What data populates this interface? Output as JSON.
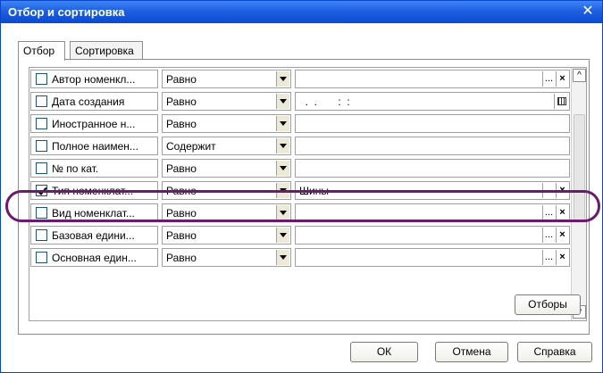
{
  "window": {
    "title": "Отбор и сортировка",
    "close_glyph": "✕"
  },
  "tabs": [
    {
      "label": "Отбор",
      "active": true
    },
    {
      "label": "Сортировка",
      "active": false
    }
  ],
  "rows": [
    {
      "checked": false,
      "name": "Автор номенкл...",
      "operator": "Равно",
      "value": "",
      "value_buttons": [
        "...",
        "×"
      ]
    },
    {
      "checked": false,
      "name": "Дата создания",
      "operator": "Равно",
      "value": "  .  .       :  :",
      "value_buttons": [
        "calendar"
      ]
    },
    {
      "checked": false,
      "name": "Иностранное н...",
      "operator": "Равно",
      "value": "",
      "value_buttons": []
    },
    {
      "checked": false,
      "name": "Полное наимен...",
      "operator": "Содержит",
      "value": "",
      "value_buttons": []
    },
    {
      "checked": false,
      "name": "№ по кат.",
      "operator": "Равно",
      "value": "",
      "value_buttons": []
    },
    {
      "checked": true,
      "name": "Тип номенклат...",
      "operator": "Равно",
      "value": "Шины",
      "value_buttons": [
        "...",
        "×"
      ]
    },
    {
      "checked": false,
      "name": "Вид номенклат...",
      "operator": "Равно",
      "value": "",
      "value_buttons": [
        "...",
        "×"
      ]
    },
    {
      "checked": false,
      "name": "Базовая едини...",
      "operator": "Равно",
      "value": "",
      "value_buttons": [
        "...",
        "×"
      ]
    },
    {
      "checked": false,
      "name": "Основная един...",
      "operator": "Равно",
      "value": "",
      "value_buttons": [
        "...",
        "×"
      ]
    }
  ],
  "buttons": {
    "filters": "Отборы",
    "ok": "ОК",
    "cancel": "Отмена",
    "help": "Справка"
  },
  "scroll": {
    "up_glyph": "^",
    "down_glyph": "v"
  },
  "colors": {
    "title_bar": "#1e5fe0",
    "highlight": "#6b1a6e"
  }
}
